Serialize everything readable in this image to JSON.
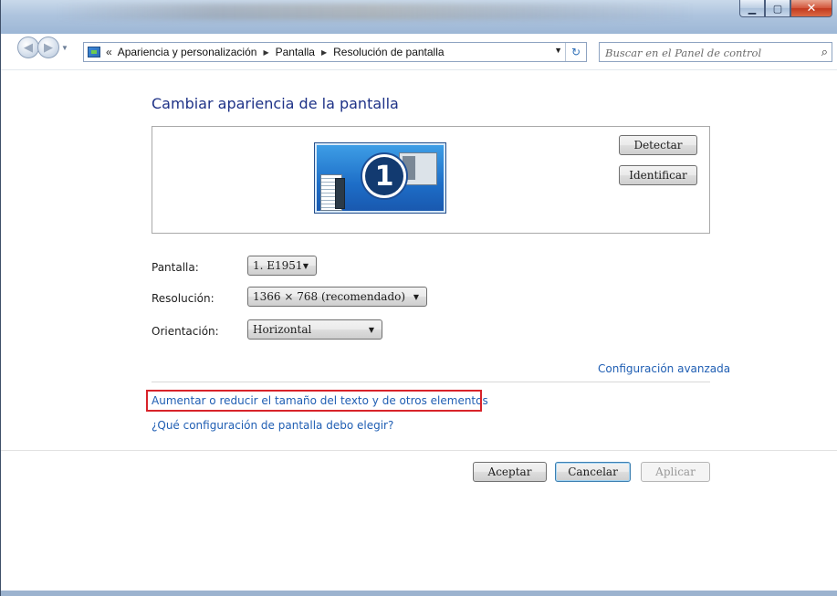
{
  "window": {
    "controls": {
      "minimize": "▁",
      "maximize": "▢",
      "close": "✕"
    }
  },
  "nav": {
    "back_glyph": "◀",
    "forward_glyph": "▶",
    "dropdown_glyph": "▼"
  },
  "address": {
    "chevron": "«",
    "breadcrumb": [
      "Apariencia y personalización",
      "Pantalla",
      "Resolución de pantalla"
    ],
    "separator": "▶",
    "dropdown_glyph": "▼",
    "refresh_glyph": "↻"
  },
  "search": {
    "placeholder": "Buscar en el Panel de control",
    "icon": "⌕"
  },
  "page": {
    "title": "Cambiar apariencia de la pantalla",
    "monitor_number": "1",
    "detect_button": "Detectar",
    "identify_button": "Identificar",
    "fields": {
      "display_label": "Pantalla:",
      "display_value": "1. E1951",
      "resolution_label": "Resolución:",
      "resolution_value": "1366 × 768 (recomendado)",
      "orientation_label": "Orientación:",
      "orientation_value": "Horizontal",
      "dropdown_glyph": "▼"
    },
    "advanced_link": "Configuración avanzada",
    "text_size_link": "Aumentar o reducir el tamaño del texto y de otros elementos",
    "help_link": "¿Qué configuración de pantalla debo elegir?",
    "ok_button": "Aceptar",
    "cancel_button": "Cancelar",
    "apply_button": "Aplicar"
  },
  "colors": {
    "title": "#1e3287",
    "link": "#1f5eb3",
    "highlight": "#d8232a"
  }
}
